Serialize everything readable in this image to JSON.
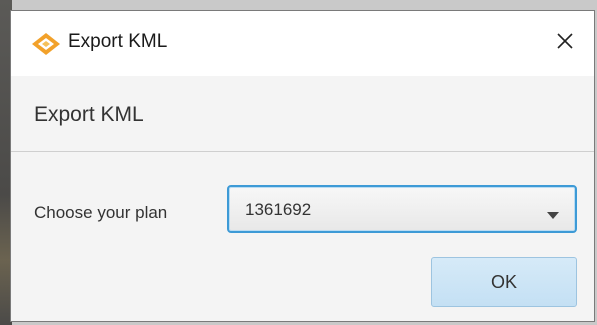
{
  "window": {
    "title": "Export KML",
    "icon": "diamond-logo-icon",
    "close_icon": "close-icon"
  },
  "header": {
    "title": "Export KML"
  },
  "form": {
    "plan_label": "Choose your plan",
    "plan_selected": "1361692",
    "ok_label": "OK"
  },
  "colors": {
    "accent": "#3d9ad6",
    "ok_button": "#cfe6f7",
    "logo_orange": "#f2a12a"
  }
}
